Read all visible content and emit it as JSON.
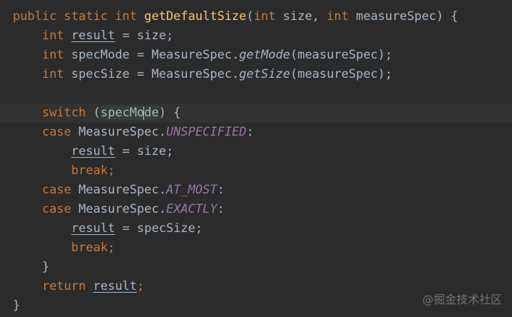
{
  "editor": {
    "current_line": 6,
    "lines": [
      [
        {
          "t": "public static int ",
          "k": "kw"
        },
        {
          "t": "getDefaultSize",
          "k": "fn"
        },
        {
          "t": "("
        },
        {
          "t": "int ",
          "k": "kw"
        },
        {
          "t": "size, "
        },
        {
          "t": "int ",
          "k": "kw"
        },
        {
          "t": "measureSpec) {"
        }
      ],
      [
        {
          "t": "    "
        },
        {
          "t": "int ",
          "k": "kw"
        },
        {
          "t": "result",
          "k": "ul"
        },
        {
          "t": " = size;"
        }
      ],
      [
        {
          "t": "    "
        },
        {
          "t": "int ",
          "k": "kw"
        },
        {
          "t": "specMode = MeasureSpec."
        },
        {
          "t": "getMode",
          "k": "it"
        },
        {
          "t": "(measureSpec);"
        }
      ],
      [
        {
          "t": "    "
        },
        {
          "t": "int ",
          "k": "kw"
        },
        {
          "t": "specSize = MeasureSpec."
        },
        {
          "t": "getSize",
          "k": "it"
        },
        {
          "t": "(measureSpec);"
        }
      ],
      [],
      [
        {
          "t": "    "
        },
        {
          "t": "switch ",
          "k": "kw"
        },
        {
          "t": "("
        },
        {
          "t": "specMo",
          "k": "hl"
        },
        {
          "t": "",
          "k": "caret"
        },
        {
          "t": "de",
          "k": "hl"
        },
        {
          "t": ") {"
        }
      ],
      [
        {
          "t": "    "
        },
        {
          "t": "case ",
          "k": "kw"
        },
        {
          "t": "MeasureSpec."
        },
        {
          "t": "UNSPECIFIED",
          "k": "const"
        },
        {
          "t": ":"
        }
      ],
      [
        {
          "t": "        "
        },
        {
          "t": "result",
          "k": "ul"
        },
        {
          "t": " = size;"
        }
      ],
      [
        {
          "t": "        "
        },
        {
          "t": "break;",
          "k": "kw"
        }
      ],
      [
        {
          "t": "    "
        },
        {
          "t": "case ",
          "k": "kw"
        },
        {
          "t": "MeasureSpec."
        },
        {
          "t": "AT_MOST",
          "k": "const"
        },
        {
          "t": ":"
        }
      ],
      [
        {
          "t": "    "
        },
        {
          "t": "case ",
          "k": "kw"
        },
        {
          "t": "MeasureSpec."
        },
        {
          "t": "EXACTLY",
          "k": "const"
        },
        {
          "t": ":"
        }
      ],
      [
        {
          "t": "        "
        },
        {
          "t": "result",
          "k": "ul"
        },
        {
          "t": " = specSize;"
        }
      ],
      [
        {
          "t": "        "
        },
        {
          "t": "break;",
          "k": "kw"
        }
      ],
      [
        {
          "t": "    }"
        }
      ],
      [
        {
          "t": "    "
        },
        {
          "t": "return ",
          "k": "kw"
        },
        {
          "t": "result",
          "k": "ul"
        },
        {
          "t": ";",
          "k": "kw"
        }
      ],
      [
        {
          "t": "}"
        }
      ]
    ]
  },
  "watermark": {
    "text": "@掘金技术社区"
  }
}
